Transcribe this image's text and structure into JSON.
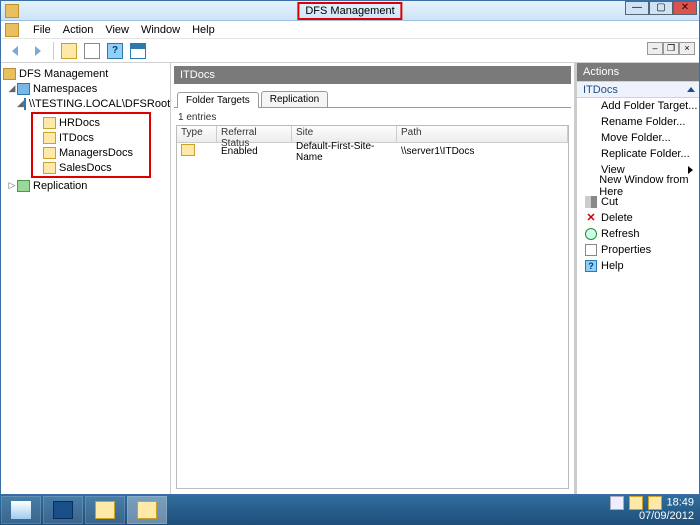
{
  "window": {
    "title": "DFS Management"
  },
  "menu": {
    "file": "File",
    "action": "Action",
    "view": "View",
    "window": "Window",
    "help": "Help"
  },
  "tree": {
    "root": "DFS Management",
    "namespaces": "Namespaces",
    "ns_path": "\\\\TESTING.LOCAL\\DFSRoot",
    "folders": [
      "HRDocs",
      "ITDocs",
      "ManagersDocs",
      "SalesDocs"
    ],
    "replication": "Replication"
  },
  "center": {
    "title": "ITDocs",
    "tabs": {
      "folder_targets": "Folder Targets",
      "replication": "Replication"
    },
    "entries_label": "1 entries",
    "columns": {
      "type": "Type",
      "referral": "Referral Status",
      "site": "Site",
      "path": "Path"
    },
    "rows": [
      {
        "referral": "Enabled",
        "site": "Default-First-Site-Name",
        "path": "\\\\server1\\ITDocs"
      }
    ]
  },
  "actions": {
    "header": "Actions",
    "sub": "ITDocs",
    "items": {
      "add_target": "Add Folder Target...",
      "rename": "Rename Folder...",
      "move": "Move Folder...",
      "replicate": "Replicate Folder...",
      "view": "View",
      "new_window": "New Window from Here",
      "cut": "Cut",
      "delete": "Delete",
      "refresh": "Refresh",
      "properties": "Properties",
      "help": "Help"
    }
  },
  "tray": {
    "time": "18:49",
    "date": "07/09/2012"
  }
}
